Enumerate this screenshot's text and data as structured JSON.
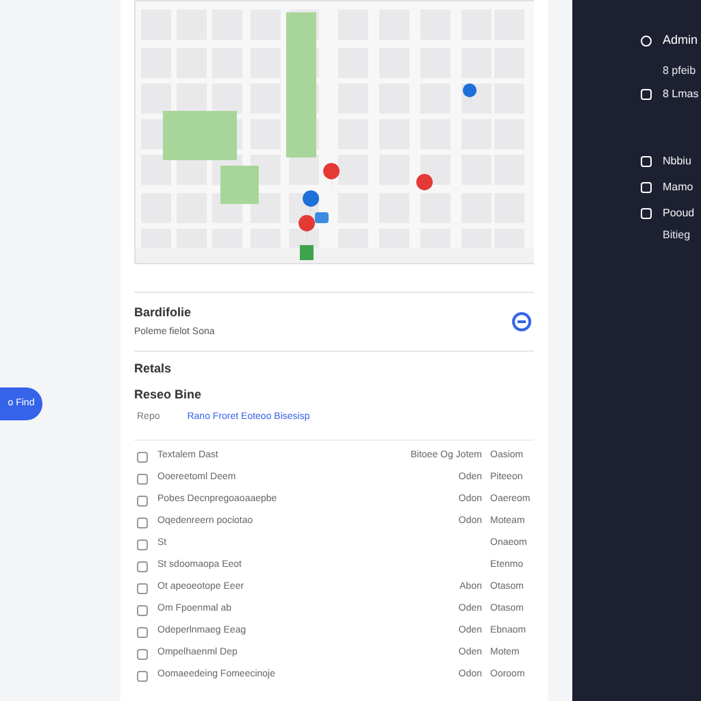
{
  "side_button": {
    "label": "o Find"
  },
  "portfolio": {
    "title": "Bardifolie",
    "subtitle": "Poleme fielot Sona",
    "expanded": true
  },
  "details": {
    "title": "Retals",
    "subtitle": "Reseo Bine",
    "label": "Repo",
    "link": "Rano Froret Eoteoo Bisesisp"
  },
  "rows": [
    {
      "name": "Textalem Dast",
      "column_3": "Bitoee Og Jotem",
      "column_4": "Oasiom",
      "checked": false
    },
    {
      "name": "Ooereetoml Deem",
      "column_3": "Oden",
      "column_4": "Piteeon",
      "checked": false
    },
    {
      "name": "Pobes Decnpregoaoaaepbe",
      "column_3": "Odon",
      "column_4": "Oaereom",
      "checked": false
    },
    {
      "name": "Oqedenreern pociotao",
      "column_3": "Odon",
      "column_4": "Moteam",
      "checked": false
    },
    {
      "name": "St",
      "column_4": "Onaeom",
      "checked": false
    },
    {
      "name": "St sdoomaopa Eeot",
      "column_4": "Etenmo",
      "checked": false
    },
    {
      "name": "Ot apeoeotope Eeer",
      "column_3": "Abon",
      "column_4": "Otasom",
      "checked": false
    },
    {
      "name": "Om Fpoenmal ab",
      "column_3": "Oden",
      "column_4": "Otasom",
      "checked": false
    },
    {
      "name": "Odeperlnmaeg Eeag",
      "column_3": "Oden",
      "column_4": "Ebnaom",
      "checked": false
    },
    {
      "name": "Ompelhaenml Dep",
      "column_3": "Oden",
      "column_4": "Motem",
      "checked": false
    },
    {
      "name": "Oomaeedeing Fomeecinoje",
      "column_3": "Odon",
      "column_4": "Ooroom",
      "checked": false
    }
  ],
  "side_panel": {
    "items": [
      {
        "kind": "heading",
        "label": "Admin"
      },
      {
        "kind": "sub",
        "label": "8 pfeib"
      },
      {
        "kind": "item",
        "label": "8 Lmas"
      },
      {
        "kind": "gap"
      },
      {
        "kind": "item",
        "label": "Nbbiu"
      },
      {
        "kind": "item",
        "label": "Mamo"
      },
      {
        "kind": "item",
        "label": "Pooud"
      },
      {
        "kind": "sub",
        "label": "Bitieg"
      }
    ]
  }
}
